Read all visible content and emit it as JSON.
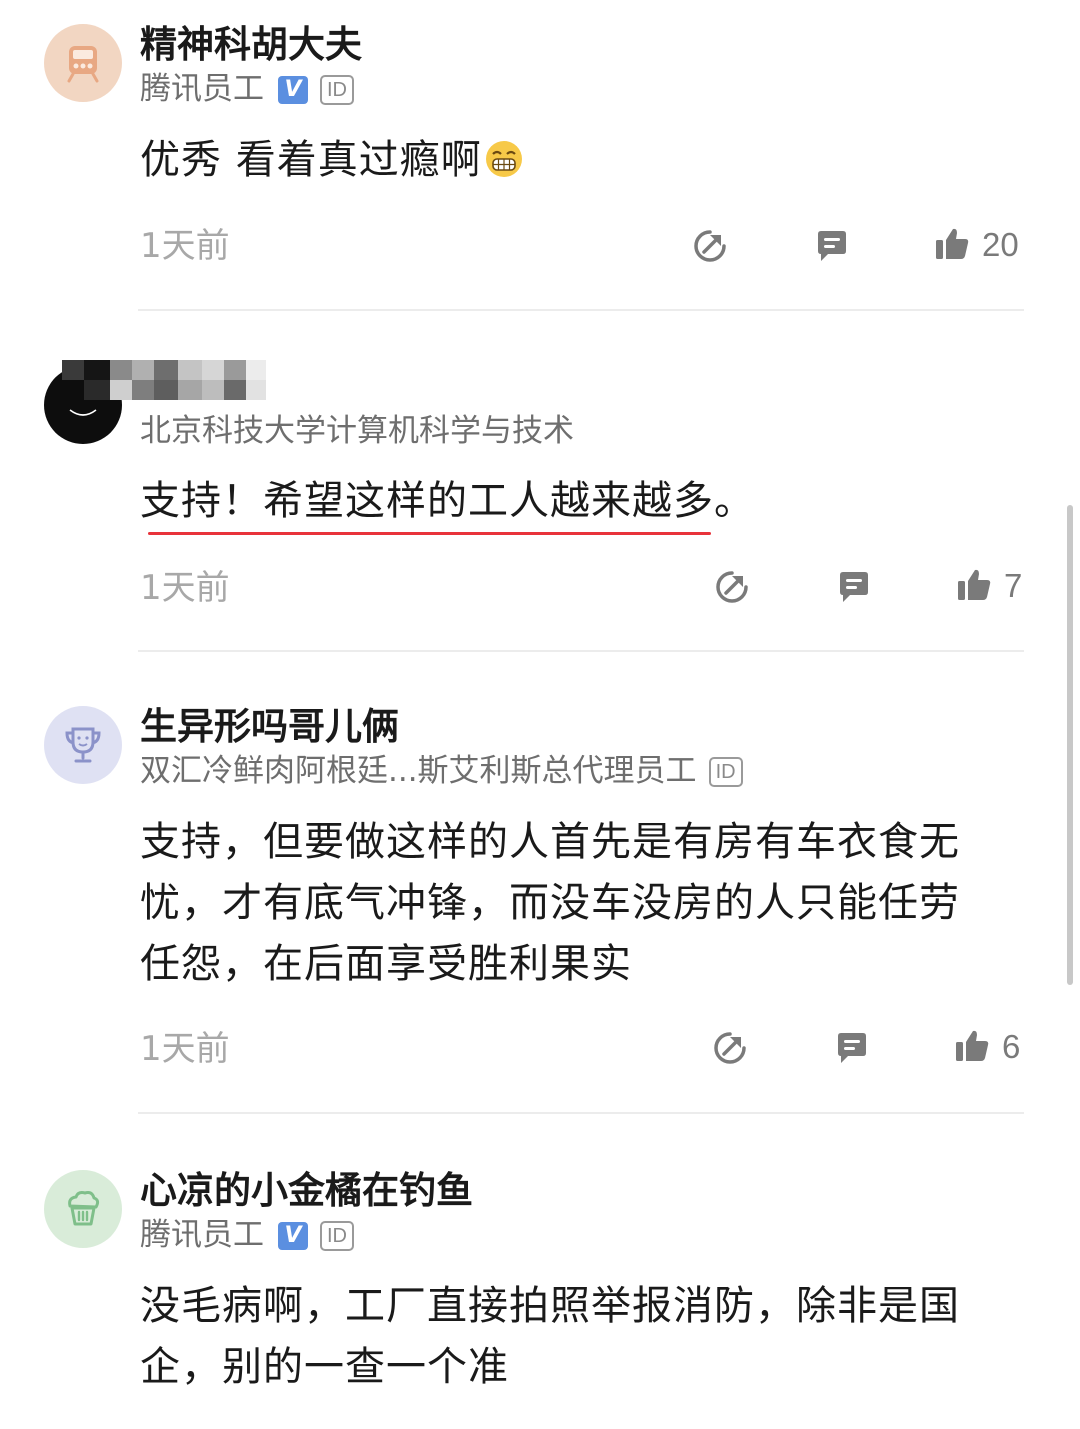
{
  "comments": [
    {
      "username": "精神科胡大夫",
      "affiliation": "腾讯员工",
      "verified": true,
      "id_badge": "ID",
      "text": "优秀 看着真过瘾啊",
      "time": "1天前",
      "likes": "20",
      "avatar_icon": "train-icon",
      "avatar_color": "#f2d6c2"
    },
    {
      "username": "",
      "affiliation": "北京科技大学计算机科学与技术",
      "text": "支持！希望这样的工人越来越多。",
      "time": "1天前",
      "likes": "7",
      "avatar_icon": "smile-icon",
      "avatar_color": "#0d0d0d"
    },
    {
      "username": "生异形吗哥儿俩",
      "affiliation": "双汇冷鲜肉阿根廷...斯艾利斯总代理员工",
      "id_badge": "ID",
      "text": "支持，但要做这样的人首先是有房有车衣食无忧，才有底气冲锋，而没车没房的人只能任劳任怨，在后面享受胜利果实",
      "time": "1天前",
      "likes": "6",
      "avatar_icon": "trophy-icon",
      "avatar_color": "#dfe1f3"
    },
    {
      "username": "心凉的小金橘在钓鱼",
      "affiliation": "腾讯员工",
      "verified": true,
      "id_badge": "ID",
      "text": "没毛病啊，工厂直接拍照举报消防，除非是国企，别的一查一个准",
      "avatar_icon": "cake-icon",
      "avatar_color": "#d9ecd9"
    }
  ],
  "badge_v": "V",
  "colors": {
    "underline": "#e8333b",
    "meta_text": "#a8a8a8",
    "icon": "#7a7a7a"
  }
}
